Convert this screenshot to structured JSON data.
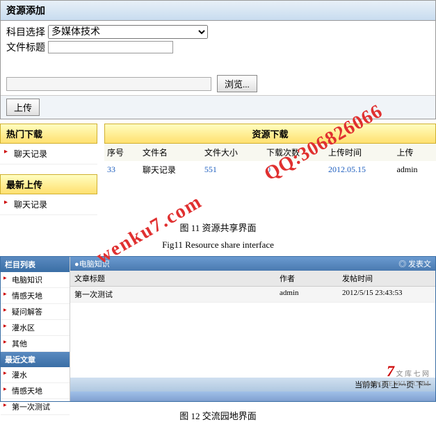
{
  "panel1": {
    "title": "资源添加",
    "subject_label": "科目选择",
    "subject_value": "多媒体技术",
    "title_label": "文件标题",
    "title_value": "",
    "browse_btn": "浏览...",
    "upload_btn": "上传"
  },
  "sidebar1": {
    "hot_header": "热门下载",
    "hot_items": [
      "聊天记录"
    ],
    "new_header": "最新上传",
    "new_items": [
      "聊天记录"
    ]
  },
  "download": {
    "header": "资源下载",
    "cols": {
      "no": "序号",
      "name": "文件名",
      "size": "文件大小",
      "count": "下载次数",
      "time": "上传时间",
      "uploader": "上传"
    },
    "rows": [
      {
        "no": "33",
        "name": "聊天记录",
        "size": "551",
        "count": "0",
        "time": "2012.05.15",
        "uploader": "admin"
      }
    ]
  },
  "caption1a": "图 11   资源共享界面",
  "caption1b": "Fig11   Resource share interface",
  "sidebar2": {
    "cat_header": "栏目列表",
    "cat_items": [
      "电脑知识",
      "情感天地",
      "疑问解答",
      "灌水区",
      "其他"
    ],
    "recent_header": "最近文章",
    "recent_items": [
      "灌水",
      "情感天地",
      "第一次测试"
    ]
  },
  "forum": {
    "crumb": "●电脑知识",
    "post_link": "◎ 发表文",
    "cols": {
      "title": "文章标题",
      "author": "作者",
      "time": "发帖时间"
    },
    "rows": [
      {
        "title": "第一次测试",
        "author": "admin",
        "time": "2012/5/15 23:43:53"
      }
    ],
    "pager": "当前第1页 上一页 下一"
  },
  "caption2": "图 12   交流园地界面",
  "watermark1": "wenku7.com",
  "watermark2": "QQ:306826066",
  "logo": {
    "big": "7",
    "t1": "文 库 七 网",
    "t2": "WWW.WENKU7.COM"
  }
}
